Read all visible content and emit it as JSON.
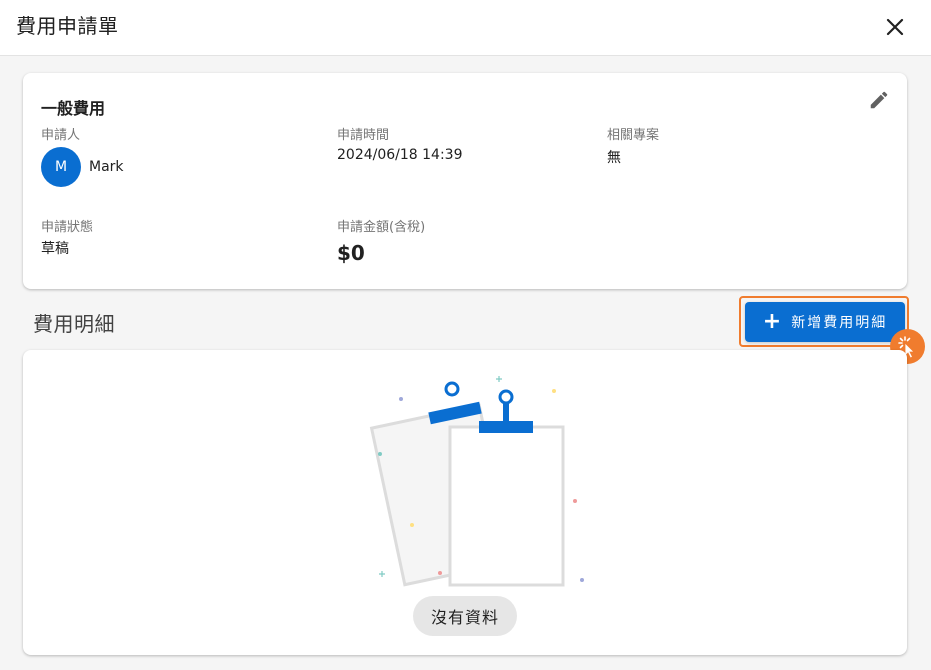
{
  "header": {
    "title": "費用申請單"
  },
  "summary": {
    "title": "一般費用",
    "applicant": {
      "label": "申請人",
      "initial": "M",
      "name": "Mark"
    },
    "apply_time": {
      "label": "申請時間",
      "value": "2024/06/18 14:39"
    },
    "project": {
      "label": "相關專案",
      "value": "無"
    },
    "status": {
      "label": "申請狀態",
      "value": "草稿"
    },
    "amount": {
      "label": "申請金額(含稅)",
      "value": "$0"
    }
  },
  "details": {
    "title": "費用明細",
    "add_label": "新增費用明細",
    "empty_label": "沒有資料"
  },
  "colors": {
    "primary": "#0a6ed1",
    "highlight": "#f07c2e"
  },
  "icons": [
    "close-icon",
    "pencil-icon",
    "plus-icon",
    "clipboard-illustration",
    "pointer-icon"
  ]
}
